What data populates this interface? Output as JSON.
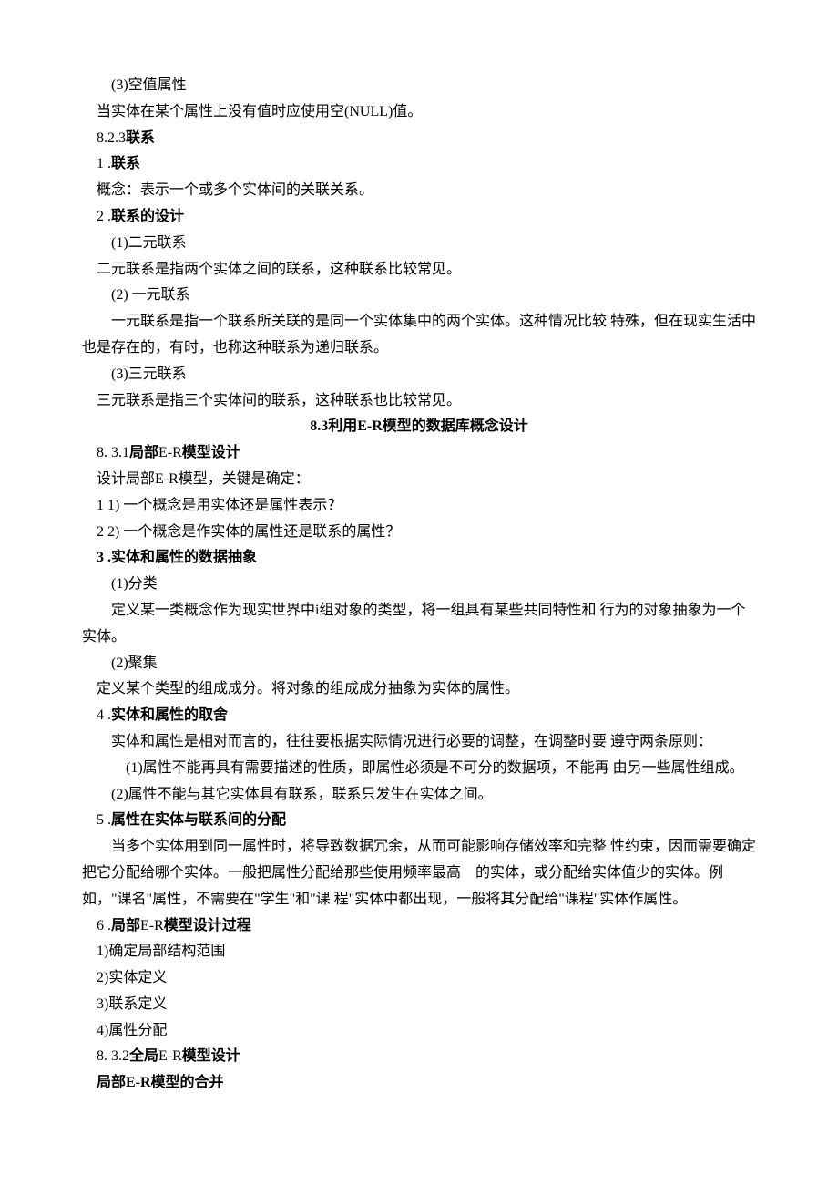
{
  "lines": [
    {
      "cls": "indent-1",
      "text": "(3)空值属性"
    },
    {
      "cls": "indent-2",
      "text": "当实体在某个属性上没有值时应使用空(NULL)值。"
    },
    {
      "cls": "indent-2",
      "text": "8.2.3<b>联系</b>"
    },
    {
      "cls": "indent-2",
      "text": "1 .<b>联系</b>"
    },
    {
      "cls": "indent-2",
      "text": "概念：表示一个或多个实体间的关联关系。"
    },
    {
      "cls": "indent-2",
      "text": "2 .<b>联系的设计</b>"
    },
    {
      "cls": "indent-1",
      "text": "(1)二元联系"
    },
    {
      "cls": "indent-2",
      "text": "二元联系是指两个实体之间的联系，这种联系比较常见。"
    },
    {
      "cls": "indent-1",
      "text": "(2) 一元联系"
    },
    {
      "cls": "no-indent",
      "text": "　　一元联系是指一个联系所关联的是同一个实体集中的两个实体。这种情况比较 特殊，但在现实生活中也是存在的，有时，也称这种联系为递归联系。"
    },
    {
      "cls": "indent-1",
      "text": "(3)三元联系"
    },
    {
      "cls": "indent-2",
      "text": "三元联系是指三个实体间的联系，这种联系也比较常见。"
    },
    {
      "cls": "center bold",
      "text": "8.3利用E-R模型的数据库概念设计"
    },
    {
      "cls": "indent-2",
      "text": "8. 3.1<b>局部</b>E-R<b>模型设计</b>"
    },
    {
      "cls": "indent-2",
      "text": "设计局部E-R模型，关键是确定："
    },
    {
      "cls": "indent-2",
      "text": "1 1) 一个概念是用实体还是属性表示？"
    },
    {
      "cls": "indent-2",
      "text": "2 2) 一个概念是作实体的属性还是联系的属性？"
    },
    {
      "cls": "indent-2",
      "text": "<b>3 .实体和属性的数据抽象</b>"
    },
    {
      "cls": "indent-1",
      "text": "(1)分类"
    },
    {
      "cls": "no-indent",
      "text": "　　定义某一类概念作为现实世界中i组对象的类型，将一组具有某些共同特性和 行为的对象抽象为一个实体。"
    },
    {
      "cls": "indent-1",
      "text": "(2)聚集"
    },
    {
      "cls": "indent-2",
      "text": "定义某个类型的组成成分。将对象的组成成分抽象为实体的属性。"
    },
    {
      "cls": "indent-2",
      "text": "4 .<b>实体和属性的取舍</b>"
    },
    {
      "cls": "no-indent",
      "text": "　　实体和属性是相对而言的，往往要根据实际情况进行必要的调整，在调整时要 遵守两条原则："
    },
    {
      "cls": "no-indent",
      "text": "　　　(1)属性不能再具有需要描述的性质，即属性必须是不可分的数据项，不能再 由另一些属性组成。"
    },
    {
      "cls": "indent-1",
      "text": "(2)属性不能与其它实体具有联系，联系只发生在实体之间。"
    },
    {
      "cls": "indent-2",
      "text": "5 .<b>属性在实体与联系间的分配</b>"
    },
    {
      "cls": "no-indent",
      "text": "　　当多个实体用到同一属性时，将导致数据冗余，从而可能影响存储效率和完整 性约束，因而需要确定把它分配给哪个实体。一般把属性分配给那些使用频率最高　的实体，或分配给实体值少的实体。例如，\"课名\"属性，不需要在\"学生\"和\"课 程\"实体中都出现，一般将其分配给\"课程\"实体作属性。"
    },
    {
      "cls": "indent-2",
      "text": "6 .<b>局部</b>E-R<b>模型设计过程</b>"
    },
    {
      "cls": "indent-2",
      "text": "1)确定局部结构范围"
    },
    {
      "cls": "indent-2",
      "text": "2)实体定义"
    },
    {
      "cls": "indent-2",
      "text": "3)联系定义"
    },
    {
      "cls": "indent-2",
      "text": "4)属性分配"
    },
    {
      "cls": "indent-2",
      "text": "8. 3.2<b>全局</b>E-R<b>模型设计</b>"
    },
    {
      "cls": "indent-2 bold",
      "text": "局部E-R模型的合并"
    }
  ]
}
